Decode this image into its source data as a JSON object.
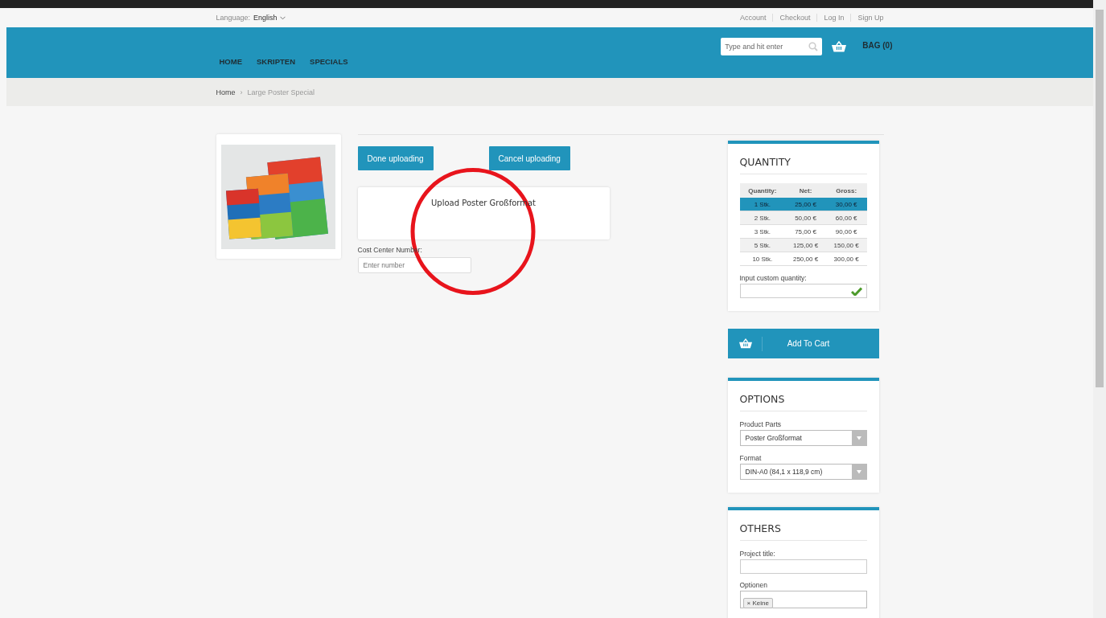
{
  "top_bar": {
    "language_label": "Language:",
    "language": "English",
    "links": [
      "Account",
      "Checkout",
      "Log In",
      "Sign Up"
    ]
  },
  "header": {
    "nav": [
      "HOME",
      "SKRIPTEN",
      "SPECIALS"
    ],
    "search": {
      "placeholder": "Type and hit enter"
    },
    "bag": "BAG (0)"
  },
  "breadcrumb": {
    "items": [
      "Home",
      "Large Poster Special"
    ],
    "separator": "›"
  },
  "upload": {
    "buttons": [
      "Done uploading",
      "Cancel uploading"
    ],
    "dropzone_text": "Upload Poster Großformat",
    "cost_center": {
      "label": "Cost Center Number:",
      "placeholder": "Enter number"
    }
  },
  "quantity": {
    "title": "QUANTITY",
    "columns": [
      "Quantity:",
      "Net:",
      "Gross:"
    ],
    "rows": [
      {
        "cells": [
          "1 Stk.",
          "25,00 €",
          "30,00 €"
        ],
        "selected": true
      },
      {
        "cells": [
          "2 Stk.",
          "50,00 €",
          "60,00 €"
        ],
        "selected": false
      },
      {
        "cells": [
          "3 Stk.",
          "75,00 €",
          "90,00 €"
        ],
        "selected": false
      },
      {
        "cells": [
          "5 Stk.",
          "125,00 €",
          "150,00 €"
        ],
        "selected": false
      },
      {
        "cells": [
          "10 Stk.",
          "250,00 €",
          "300,00 €"
        ],
        "selected": false
      }
    ],
    "custom_label": "Input custom quantity:"
  },
  "add_to_cart": "Add To Cart",
  "options": {
    "title": "OPTIONS",
    "fields": [
      {
        "label": "Product Parts",
        "value": "Poster Großformat"
      },
      {
        "label": "Format",
        "value": "DIN-A0 (84,1 x 118,9 cm)"
      }
    ]
  },
  "others": {
    "title": "OTHERS",
    "project_title_label": "Project title:",
    "optionen_label": "Optionen",
    "tags": [
      {
        "remove": "×",
        "label": "Keine"
      }
    ]
  }
}
